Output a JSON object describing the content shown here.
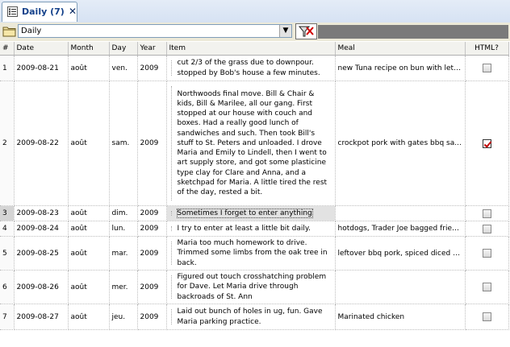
{
  "tab": {
    "title": "Daily (7)",
    "close": "✕"
  },
  "toolbar": {
    "combo_value": "Daily",
    "combo_arrow": "▼"
  },
  "columns": [
    "#",
    "Date",
    "Month",
    "Day",
    "Year",
    "Item",
    "Meal",
    "HTML?"
  ],
  "rows": [
    {
      "num": "1",
      "date": "2009-08-21",
      "month": "août",
      "day": "ven.",
      "year": "2009",
      "item": "cut 2/3 of the grass due to downpour. stopped by Bob's house a few minutes.",
      "meal": "new Tuna recipe on bun with lett...",
      "html": false
    },
    {
      "num": "2",
      "date": "2009-08-22",
      "month": "août",
      "day": "sam.",
      "year": "2009",
      "item": "Northwoods final move. Bill & Chair & kids, Bill & Marilee, all our gang.  First stopped at our house with couch and boxes. Had a really good lunch of sandwiches and such. Then took Bill's stuff to St. Peters and unloaded. I drove Maria and Emily to Lindell, then I went to art supply store, and got some plasticine type clay for Clare and Anna, and a sketchpad for Maria. A little tired the rest of the day, rested a bit.",
      "meal": "crockpot pork with gates bbq sa...",
      "html": true
    },
    {
      "num": "3",
      "date": "2009-08-23",
      "month": "août",
      "day": "dim.",
      "year": "2009",
      "item": "Sometimes I forget to enter anything",
      "meal": "",
      "html": false
    },
    {
      "num": "4",
      "date": "2009-08-24",
      "month": "août",
      "day": "lun.",
      "year": "2009",
      "item": "I try to enter at least a little bit daily.",
      "meal": "hotdogs, Trader Joe bagged fries...",
      "html": false
    },
    {
      "num": "5",
      "date": "2009-08-25",
      "month": "août",
      "day": "mar.",
      "year": "2009",
      "item": "Maria too much homework to drive. Trimmed some limbs from the oak tree in back.",
      "meal": "leftover bbq pork, spiced diced t...",
      "html": false
    },
    {
      "num": "6",
      "date": "2009-08-26",
      "month": "août",
      "day": "mer.",
      "year": "2009",
      "item": "Figured out touch crosshatching problem for Dave. Let Maria drive through backroads of St. Ann",
      "meal": "",
      "html": false
    },
    {
      "num": "7",
      "date": "2009-08-27",
      "month": "août",
      "day": "jeu.",
      "year": "2009",
      "item": "Laid out bunch of holes in ug, fun. Gave Maria parking practice.",
      "meal": "Marinated chicken",
      "html": false
    }
  ],
  "selected_row": "3",
  "colors": {
    "tab_title": "#15428b",
    "checkmark": "#c00000",
    "toolbar_bg": "#ece9d8"
  },
  "icons": {
    "tab": "list-icon",
    "folder": "folder-icon",
    "filter": "filter-clear-icon",
    "close": "close-icon"
  }
}
